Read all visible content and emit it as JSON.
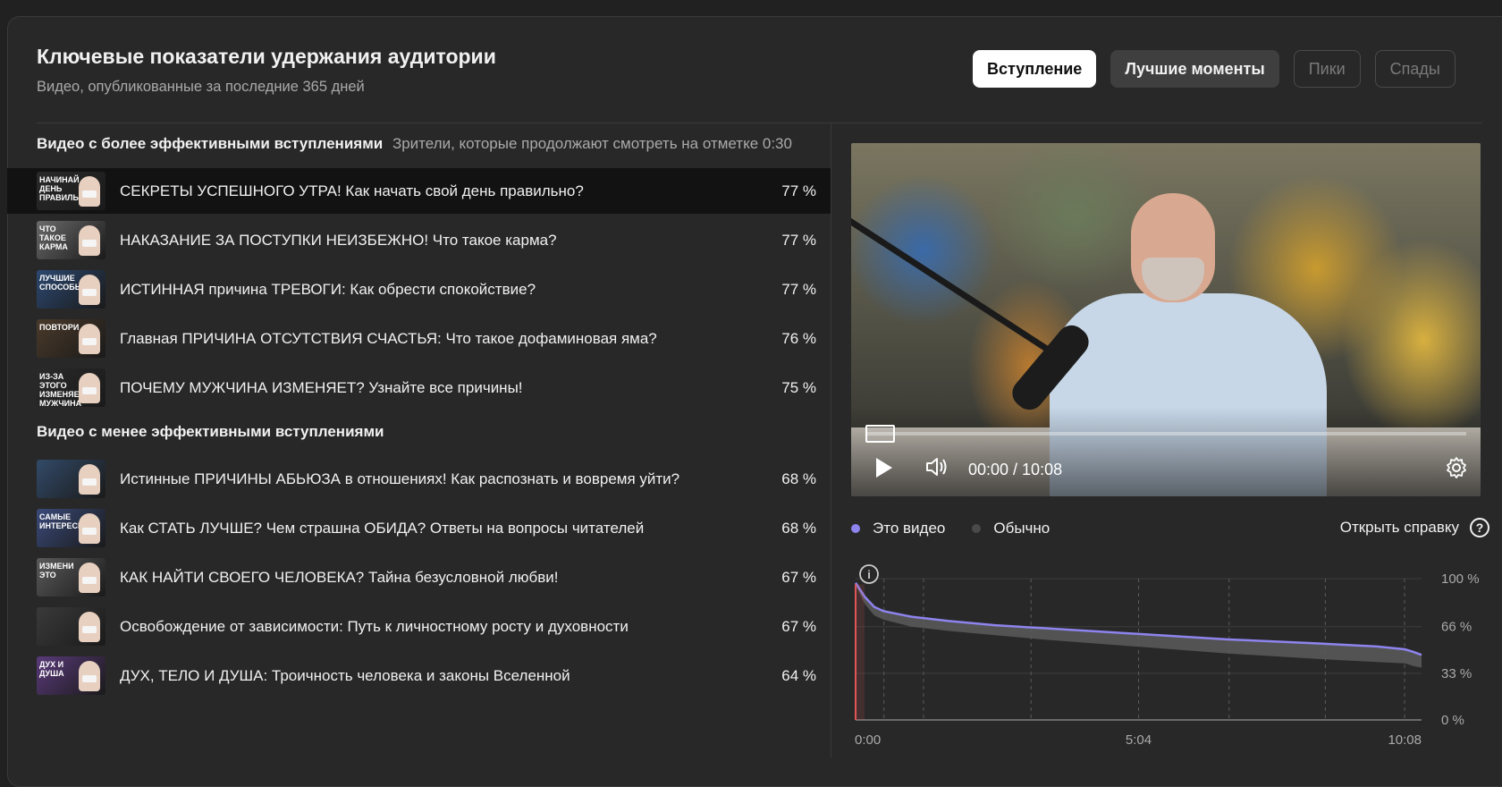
{
  "header": {
    "title": "Ключевые показатели удержания аудитории",
    "subtitle": "Видео, опубликованные за последние 365 дней"
  },
  "tabs": [
    {
      "label": "Вступление",
      "state": "active"
    },
    {
      "label": "Лучшие моменты",
      "state": "secondary"
    },
    {
      "label": "Пики",
      "state": "disabled"
    },
    {
      "label": "Спады",
      "state": "disabled"
    }
  ],
  "better_section": {
    "heading": "Видео с более эффективными вступлениями",
    "note": "Зрители, которые продолжают смотреть на отметке 0:30",
    "items": [
      {
        "title": "СЕКРЕТЫ УСПЕШНОГО УТРА! Как начать свой день правильно?",
        "pct": "77 %",
        "thumb_text": "НАЧИНАЙ ДЕНЬ ПРАВИЛЬНО",
        "thumb_color": "#2a2a2a"
      },
      {
        "title": "НАКАЗАНИЕ ЗА ПОСТУПКИ НЕИЗБЕЖНО! Что такое карма?",
        "pct": "77 %",
        "thumb_text": "ЧТО ТАКОЕ КАРМА",
        "thumb_color": "#6a6a6a"
      },
      {
        "title": "ИСТИННАЯ причина ТРЕВОГИ: Как обрести спокойствие?",
        "pct": "77 %",
        "thumb_text": "ЛУЧШИЕ СПОСОБЫ",
        "thumb_color": "#2c4870"
      },
      {
        "title": "Главная ПРИЧИНА ОТСУТСТВИЯ СЧАСТЬЯ: Что такое дофаминовая яма?",
        "pct": "76 %",
        "thumb_text": "ПОВТОРИ",
        "thumb_color": "#4a3a2a"
      },
      {
        "title": "ПОЧЕМУ МУЖЧИНА ИЗМЕНЯЕТ? Узнайте все причины!",
        "pct": "75 %",
        "thumb_text": "ИЗ-ЗА ЭТОГО ИЗМЕНЯЕТ МУЖЧИНА",
        "thumb_color": "#2a2a2a"
      }
    ]
  },
  "worse_section": {
    "heading": "Видео с менее эффективными вступлениями",
    "items": [
      {
        "title": "Истинные ПРИЧИНЫ АБЬЮЗА в отношениях! Как распознать и вовремя уйти?",
        "pct": "68 %",
        "thumb_text": "",
        "thumb_color": "#324a68"
      },
      {
        "title": "Как СТАТЬ ЛУЧШЕ? Чем страшна ОБИДА? Ответы на вопросы читателей",
        "pct": "68 %",
        "thumb_text": "САМЫЕ ИНТЕРЕСНЫЕ",
        "thumb_color": "#3a4a7a"
      },
      {
        "title": "КАК НАЙТИ СВОЕГО ЧЕЛОВЕКА? Тайна безусловной любви!",
        "pct": "67 %",
        "thumb_text": "ИЗМЕНИ ЭТО",
        "thumb_color": "#5a5a5a"
      },
      {
        "title": "Освобождение от зависимости: Путь к личностному росту и духовности",
        "pct": "67 %",
        "thumb_text": "",
        "thumb_color": "#3a3a3a"
      },
      {
        "title": "ДУХ, ТЕЛО И ДУША: Троичность человека и законы Вселенной",
        "pct": "64 %",
        "thumb_text": "ДУХ И ДУША",
        "thumb_color": "#5a3a7a"
      }
    ]
  },
  "player": {
    "time": "00:00 / 10:08",
    "progress": 0
  },
  "legend": {
    "this_video": "Это видео",
    "typical": "Обычно",
    "help": "Открыть справку",
    "this_color": "#8e84ee",
    "typical_color": "#4a4a4a"
  },
  "chart_data": {
    "type": "area",
    "x_ticks": [
      "0:00",
      "5:04",
      "10:08"
    ],
    "y_ticks": [
      "100 %",
      "66 %",
      "33 %",
      "0 %"
    ],
    "xlim": [
      0,
      608
    ],
    "ylim": [
      0,
      100
    ],
    "series": [
      {
        "name": "Это видео",
        "x": [
          0,
          10,
          20,
          30,
          60,
          100,
          150,
          200,
          300,
          400,
          500,
          560,
          590,
          600,
          608
        ],
        "y": [
          97,
          87,
          80,
          77,
          73,
          70,
          67,
          65,
          61,
          57,
          54,
          52,
          50,
          48,
          46
        ]
      },
      {
        "name": "Обычно",
        "x": [
          0,
          10,
          20,
          30,
          60,
          100,
          150,
          200,
          300,
          400,
          500,
          560,
          590,
          600,
          608
        ],
        "y": [
          95,
          82,
          74,
          71,
          66,
          63,
          60,
          57,
          52,
          47,
          43,
          41,
          40,
          38,
          37
        ]
      }
    ]
  }
}
